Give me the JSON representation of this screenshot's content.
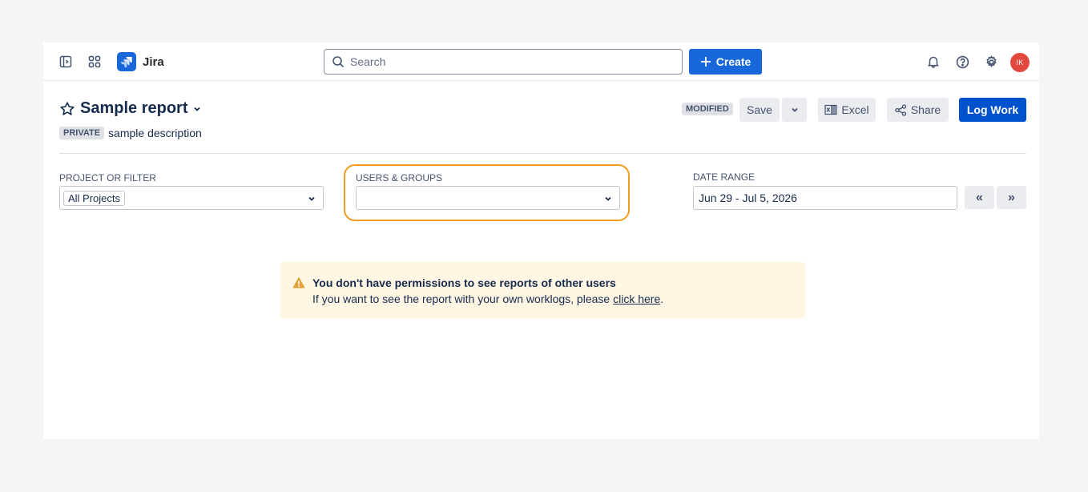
{
  "app": {
    "name": "Jira"
  },
  "search": {
    "placeholder": "Search"
  },
  "header": {
    "create_label": "Create",
    "avatar_initials": "IK"
  },
  "report": {
    "title": "Sample report",
    "visibility": "PRIVATE",
    "description": "sample description",
    "status": "MODIFIED"
  },
  "toolbar": {
    "save_label": "Save",
    "excel_label": "Excel",
    "share_label": "Share",
    "log_work_label": "Log Work"
  },
  "filters": {
    "project_label": "PROJECT OR FILTER",
    "project_value": "All Projects",
    "users_label": "USERS & GROUPS",
    "users_value": "",
    "date_label": "DATE RANGE",
    "date_value": "Jun 29 - Jul 5, 2026",
    "prev_label": "«",
    "next_label": "»"
  },
  "warning": {
    "title": "You don't have permissions to see reports of other users",
    "body": "If you want to see the report with your own worklogs, please ",
    "link": "click here",
    "end": "."
  },
  "colors": {
    "primary": "#1868db",
    "highlight": "#f09c1d",
    "warning_bg": "#fff7e3"
  }
}
